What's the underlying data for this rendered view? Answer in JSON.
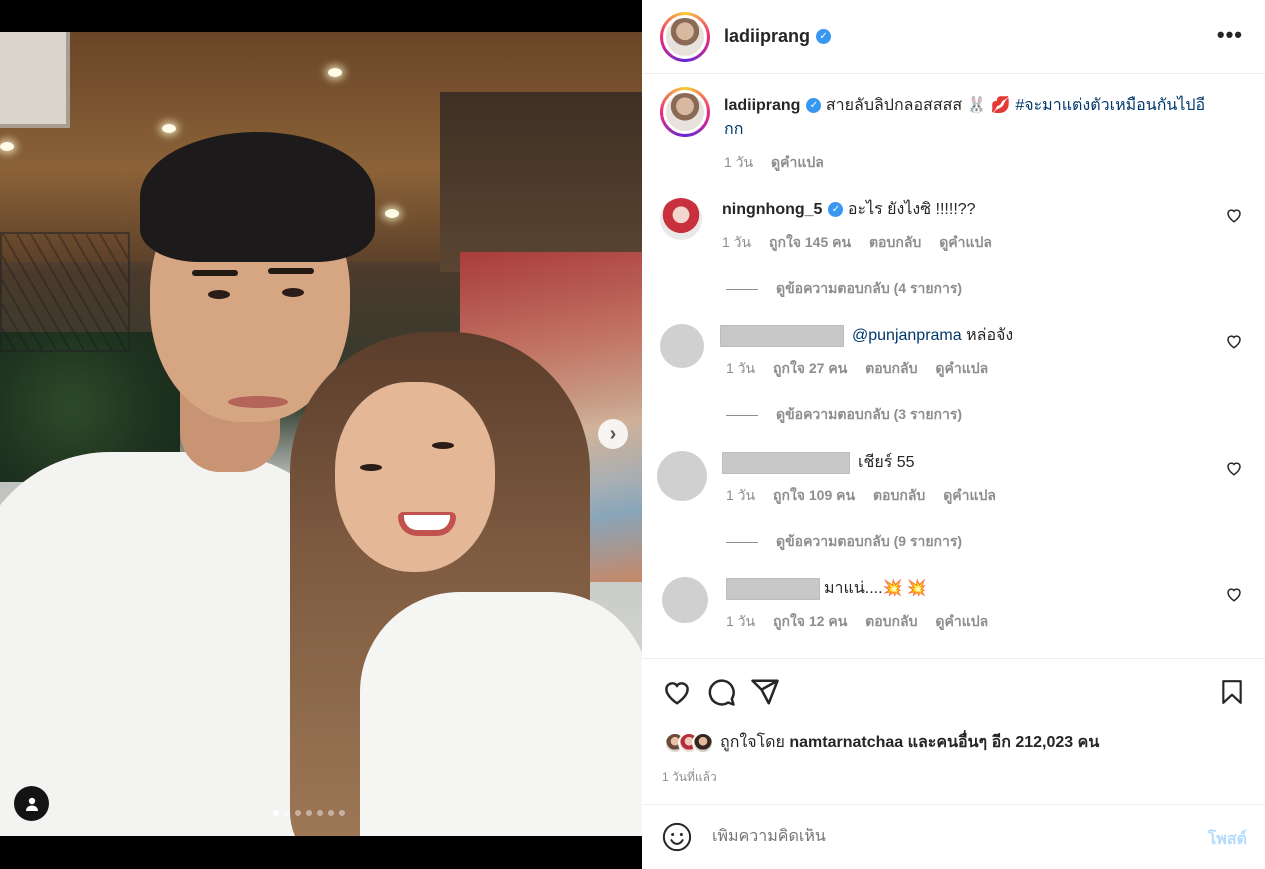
{
  "post": {
    "username": "ladiiprang",
    "verified_badge": "✓",
    "more_icon": "•••",
    "caption": {
      "username": "ladiiprang",
      "text": "สายลับลิปกลอสสสส 🐰 💋",
      "hashtag": "#จะมาแต่งตัวเหมือนกันไปอีกก",
      "time": "1 วัน",
      "translate": "ดูคำแปล"
    },
    "media": {
      "carousel_dots": 7,
      "active_dot": 0,
      "next_icon": "›"
    }
  },
  "comments": [
    {
      "username": "ningnhong_5",
      "verified": true,
      "text": "อะไร ยังไงซิ !!!!!??",
      "time": "1 วัน",
      "likes": "ถูกใจ 145 คน",
      "reply": "ตอบกลับ",
      "translate": "ดูคำแปล",
      "view_replies": "ดูข้อความตอบกลับ (4 รายการ)"
    },
    {
      "username": "",
      "mention": "@punjanprama",
      "text": "หล่อจัง",
      "time": "1 วัน",
      "likes": "ถูกใจ 27 คน",
      "reply": "ตอบกลับ",
      "translate": "ดูคำแปล",
      "view_replies": "ดูข้อความตอบกลับ (3 รายการ)"
    },
    {
      "username": "",
      "text": "เชียร์ 55",
      "time": "1 วัน",
      "likes": "ถูกใจ 109 คน",
      "reply": "ตอบกลับ",
      "translate": "ดูคำแปล",
      "view_replies": "ดูข้อความตอบกลับ (9 รายการ)"
    },
    {
      "username": "",
      "text": "มาแน่....💥 💥",
      "time": "1 วัน",
      "likes": "ถูกใจ 12 คน",
      "reply": "ตอบกลับ",
      "translate": "ดูคำแปล"
    }
  ],
  "footer": {
    "liked_prefix": "ถูกใจโดย",
    "liked_user": "namtarnatchaa",
    "liked_suffix": "และคนอื่นๆ อีก 212,023 คน",
    "time_ago": "1 วันที่แล้ว",
    "comment_placeholder": "เพิ่มความคิดเห็น",
    "post_button": "โพสต์"
  },
  "colors": {
    "verified": "#3897f0",
    "link": "#00376b",
    "muted": "#8e8e8e",
    "post_button": "#b3dbff"
  }
}
